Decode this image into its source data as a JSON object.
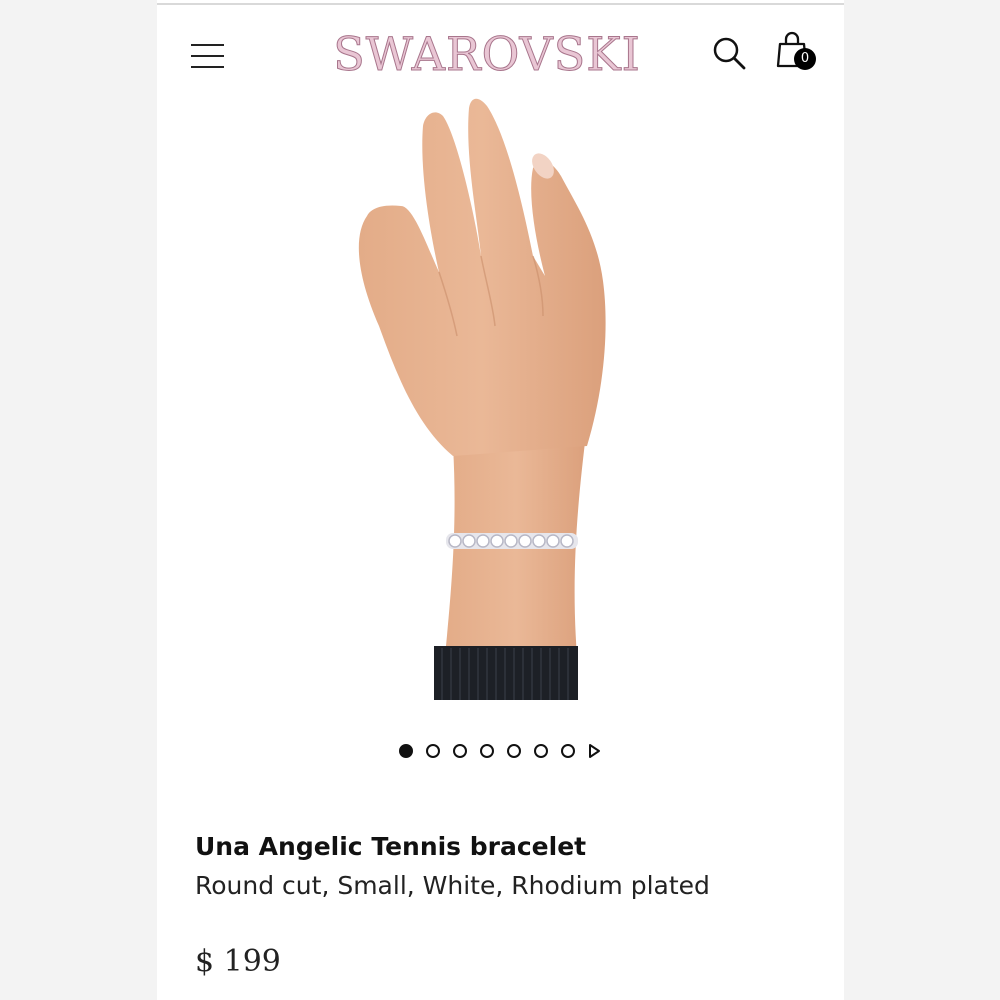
{
  "header": {
    "brand": "SWAROVSKI",
    "menu_icon": "hamburger-menu-icon",
    "search_icon": "search-icon",
    "bag_icon": "shopping-bag-icon",
    "bag_count": "0"
  },
  "product": {
    "name": "Una Angelic Tennis bracelet",
    "description": "Round cut, Small, White, Rhodium plated",
    "price": "$ 199"
  },
  "carousel": {
    "total_slides": 7,
    "active_index": 0,
    "next_icon": "play-arrow-icon"
  },
  "colors": {
    "brand_logo_fill": "#e9c6d4",
    "brand_logo_outline": "#a8758c",
    "text": "#111111"
  }
}
